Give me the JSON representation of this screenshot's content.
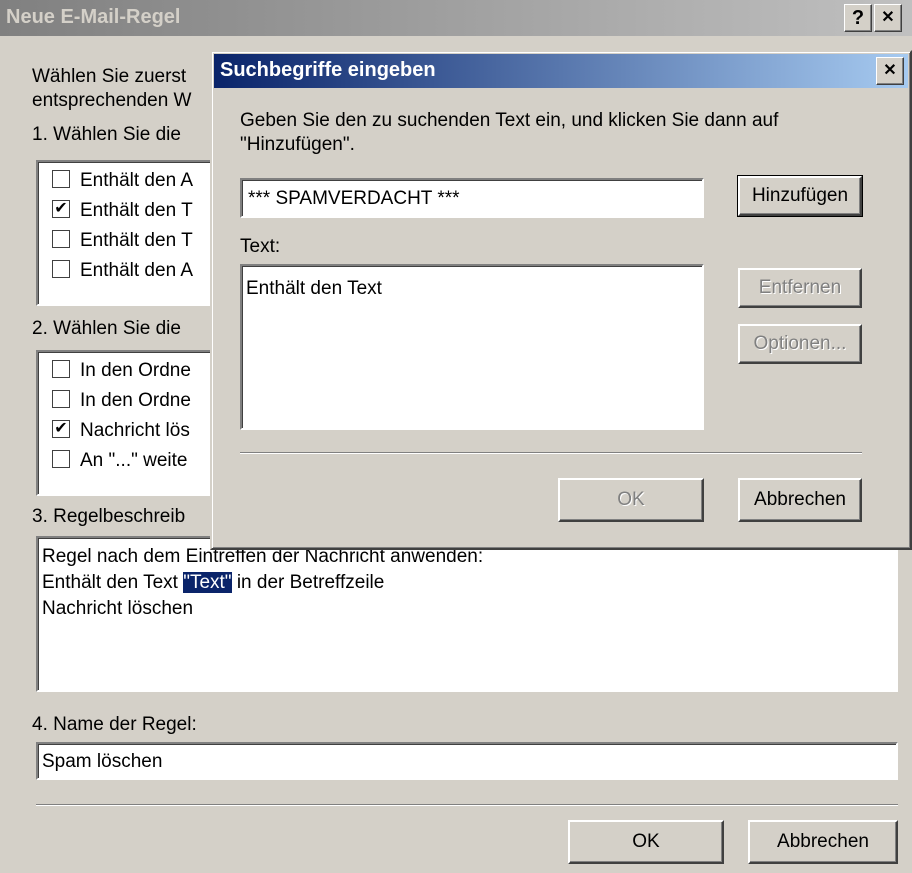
{
  "main": {
    "title": "Neue E-Mail-Regel",
    "help_btn": "?",
    "close_btn": "✕",
    "intro_line1": "Wählen Sie zuerst",
    "intro_line2": "entsprechenden W",
    "step1_label": "1. Wählen Sie die",
    "conditions": [
      {
        "label": "Enthält den A",
        "checked": false
      },
      {
        "label": "Enthält den T",
        "checked": true
      },
      {
        "label": "Enthält den T",
        "checked": false
      },
      {
        "label": "Enthält den A",
        "checked": false
      }
    ],
    "step2_label": "2. Wählen Sie die",
    "actions": [
      {
        "label": "In den Ordne",
        "checked": false
      },
      {
        "label": "In den Ordne",
        "checked": false
      },
      {
        "label": "Nachricht lös",
        "checked": true
      },
      {
        "label": "An \"...\" weite",
        "checked": false
      }
    ],
    "step3_label": "3. Regelbeschreib",
    "description": {
      "line1": "Regel nach dem Eintreffen der Nachricht anwenden:",
      "line2_prefix": "Enthält den Text ",
      "line2_link": "\"Text\"",
      "line2_suffix": " in der Betreffzeile",
      "line3": "Nachricht löschen"
    },
    "step4_label": "4. Name der Regel:",
    "rule_name": "Spam löschen",
    "ok_label": "OK",
    "cancel_label": "Abbrechen"
  },
  "dialog": {
    "title": "Suchbegriffe eingeben",
    "close_btn": "✕",
    "instruction_line1": "Geben Sie den zu suchenden Text ein, und klicken Sie dann auf",
    "instruction_line2": "\"Hinzufügen\".",
    "search_value": "*** SPAMVERDACHT ***",
    "add_label": "Hinzufügen",
    "text_label": "Text:",
    "text_items": [
      "Enthält den Text"
    ],
    "remove_label": "Entfernen",
    "options_label": "Optionen...",
    "ok_label": "OK",
    "cancel_label": "Abbrechen"
  }
}
